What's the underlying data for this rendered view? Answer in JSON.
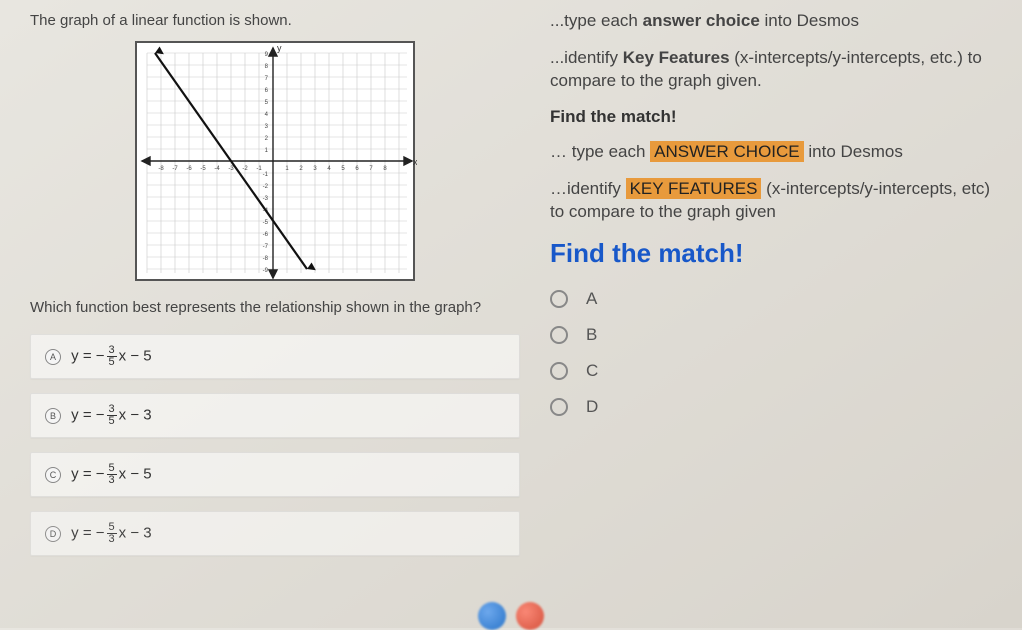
{
  "prompt": {
    "title": "The graph of a linear function is shown.",
    "question": "Which function best represents the relationship shown in the graph?"
  },
  "choices": [
    {
      "letter": "A",
      "prefix": "y = −",
      "num": "3",
      "den": "5",
      "suffix": "x − 5"
    },
    {
      "letter": "B",
      "prefix": "y = −",
      "num": "3",
      "den": "5",
      "suffix": "x − 3"
    },
    {
      "letter": "C",
      "prefix": "y = −",
      "num": "5",
      "den": "3",
      "suffix": "x − 5"
    },
    {
      "letter": "D",
      "prefix": "y = −",
      "num": "5",
      "den": "3",
      "suffix": "x − 3"
    }
  ],
  "instructions": {
    "line1_pre": "...type each ",
    "line1_bold": "answer choice",
    "line1_post": " into Desmos",
    "line2_pre": "...identify ",
    "line2_bold": "Key Features",
    "line2_post": " (x-intercepts/y-intercepts, etc.) to compare to the graph given.",
    "find1": "Find the match!",
    "line3_pre": "… type each ",
    "line3_hl": "ANSWER CHOICE",
    "line3_post": " into Desmos",
    "line4_pre": "…identify ",
    "line4_hl": "KEY FEATURES",
    "line4_post": " (x-intercepts/y-intercepts, etc) to compare to the graph given",
    "find2": "Find the match!"
  },
  "radio_options": [
    "A",
    "B",
    "C",
    "D"
  ],
  "chart_data": {
    "type": "line",
    "title": "",
    "xlabel": "x",
    "ylabel": "y",
    "xlim": [
      -9,
      9
    ],
    "ylim": [
      -9,
      9
    ],
    "grid": true,
    "series": [
      {
        "name": "line",
        "points": [
          {
            "x": -8.4,
            "y": 9
          },
          {
            "x": 2.4,
            "y": -9
          }
        ],
        "note": "approximate line with slope -5/3 and y-intercept -5; x-intercept -3"
      }
    ]
  }
}
